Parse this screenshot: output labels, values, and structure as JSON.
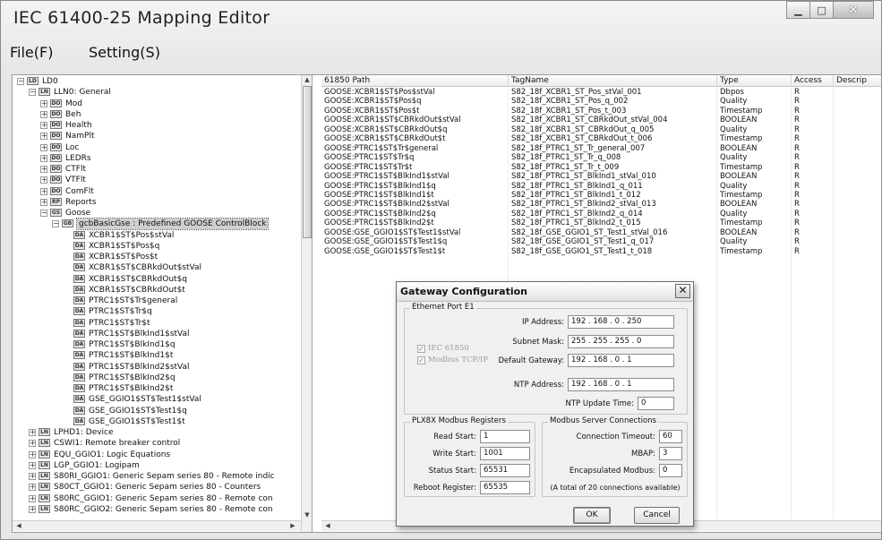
{
  "window": {
    "title": "IEC 61400-25 Mapping Editor",
    "minimize": "▁",
    "maximize": "□",
    "close": "✕"
  },
  "menu": {
    "file": "File(F)",
    "setting": "Setting(S)"
  },
  "tree": {
    "nodes": [
      {
        "label": "LD0",
        "icon": "LD",
        "exp": "−",
        "indent": 0
      },
      {
        "label": "LLN0: General",
        "icon": "LN",
        "exp": "−",
        "indent": 1
      },
      {
        "label": "Mod",
        "icon": "DO",
        "exp": "+",
        "indent": 2
      },
      {
        "label": "Beh",
        "icon": "DO",
        "exp": "+",
        "indent": 2
      },
      {
        "label": "Health",
        "icon": "DO",
        "exp": "+",
        "indent": 2
      },
      {
        "label": "NamPlt",
        "icon": "DO",
        "exp": "+",
        "indent": 2
      },
      {
        "label": "Loc",
        "icon": "DO",
        "exp": "+",
        "indent": 2
      },
      {
        "label": "LEDRs",
        "icon": "DO",
        "exp": "+",
        "indent": 2
      },
      {
        "label": "CTFlt",
        "icon": "DO",
        "exp": "+",
        "indent": 2
      },
      {
        "label": "VTFlt",
        "icon": "DO",
        "exp": "+",
        "indent": 2
      },
      {
        "label": "ComFlt",
        "icon": "DO",
        "exp": "+",
        "indent": 2
      },
      {
        "label": "Reports",
        "icon": "RP",
        "exp": "+",
        "indent": 2
      },
      {
        "label": "Goose",
        "icon": "GS",
        "exp": "−",
        "indent": 2
      },
      {
        "label": "gcbBasicGse : Predefined GOOSE ControlBlock",
        "icon": "GB",
        "exp": "−",
        "indent": 3,
        "selected": true
      },
      {
        "label": "XCBR1$ST$Pos$stVal",
        "icon": "DA",
        "indent": 4
      },
      {
        "label": "XCBR1$ST$Pos$q",
        "icon": "DA",
        "indent": 4
      },
      {
        "label": "XCBR1$ST$Pos$t",
        "icon": "DA",
        "indent": 4
      },
      {
        "label": "XCBR1$ST$CBRkdOut$stVal",
        "icon": "DA",
        "indent": 4
      },
      {
        "label": "XCBR1$ST$CBRkdOut$q",
        "icon": "DA",
        "indent": 4
      },
      {
        "label": "XCBR1$ST$CBRkdOut$t",
        "icon": "DA",
        "indent": 4
      },
      {
        "label": "PTRC1$ST$Tr$general",
        "icon": "DA",
        "indent": 4
      },
      {
        "label": "PTRC1$ST$Tr$q",
        "icon": "DA",
        "indent": 4
      },
      {
        "label": "PTRC1$ST$Tr$t",
        "icon": "DA",
        "indent": 4
      },
      {
        "label": "PTRC1$ST$BlkInd1$stVal",
        "icon": "DA",
        "indent": 4
      },
      {
        "label": "PTRC1$ST$BlkInd1$q",
        "icon": "DA",
        "indent": 4
      },
      {
        "label": "PTRC1$ST$BlkInd1$t",
        "icon": "DA",
        "indent": 4
      },
      {
        "label": "PTRC1$ST$BlkInd2$stVal",
        "icon": "DA",
        "indent": 4
      },
      {
        "label": "PTRC1$ST$BlkInd2$q",
        "icon": "DA",
        "indent": 4
      },
      {
        "label": "PTRC1$ST$BlkInd2$t",
        "icon": "DA",
        "indent": 4
      },
      {
        "label": "GSE_GGIO1$ST$Test1$stVal",
        "icon": "DA",
        "indent": 4
      },
      {
        "label": "GSE_GGIO1$ST$Test1$q",
        "icon": "DA",
        "indent": 4
      },
      {
        "label": "GSE_GGIO1$ST$Test1$t",
        "icon": "DA",
        "indent": 4
      },
      {
        "label": "LPHD1: Device",
        "icon": "LN",
        "exp": "+",
        "indent": 1
      },
      {
        "label": "CSWI1: Remote breaker control",
        "icon": "LN",
        "exp": "+",
        "indent": 1
      },
      {
        "label": "EQU_GGIO1: Logic Equations",
        "icon": "LN",
        "exp": "+",
        "indent": 1
      },
      {
        "label": "LGP_GGIO1: Logipam",
        "icon": "LN",
        "exp": "+",
        "indent": 1
      },
      {
        "label": "S80RI_GGIO1: Generic Sepam series 80 - Remote indic",
        "icon": "LN",
        "exp": "+",
        "indent": 1
      },
      {
        "label": "S80CT_GGIO1: Generic Sepam series 80 - Counters",
        "icon": "LN",
        "exp": "+",
        "indent": 1
      },
      {
        "label": "S80RC_GGIO1: Generic Sepam series 80 - Remote con",
        "icon": "LN",
        "exp": "+",
        "indent": 1
      },
      {
        "label": "S80RC_GGIO2: Generic Sepam series 80 - Remote con",
        "icon": "LN",
        "exp": "+",
        "indent": 1
      }
    ]
  },
  "grid": {
    "headers": [
      "61850 Path",
      "TagName",
      "Type",
      "Access",
      "Descrip"
    ],
    "rows": [
      [
        "GOOSE:XCBR1$ST$Pos$stVal",
        "S82_18f_XCBR1_ST_Pos_stVal_001",
        "Dbpos",
        "R"
      ],
      [
        "GOOSE:XCBR1$ST$Pos$q",
        "S82_18f_XCBR1_ST_Pos_q_002",
        "Quality",
        "R"
      ],
      [
        "GOOSE:XCBR1$ST$Pos$t",
        "S82_18f_XCBR1_ST_Pos_t_003",
        "Timestamp",
        "R"
      ],
      [
        "GOOSE:XCBR1$ST$CBRkdOut$stVal",
        "S82_18f_XCBR1_ST_CBRkdOut_stVal_004",
        "BOOLEAN",
        "R"
      ],
      [
        "GOOSE:XCBR1$ST$CBRkdOut$q",
        "S82_18f_XCBR1_ST_CBRkdOut_q_005",
        "Quality",
        "R"
      ],
      [
        "GOOSE:XCBR1$ST$CBRkdOut$t",
        "S82_18f_XCBR1_ST_CBRkdOut_t_006",
        "Timestamp",
        "R"
      ],
      [
        "GOOSE:PTRC1$ST$Tr$general",
        "S82_18f_PTRC1_ST_Tr_general_007",
        "BOOLEAN",
        "R"
      ],
      [
        "GOOSE:PTRC1$ST$Tr$q",
        "S82_18f_PTRC1_ST_Tr_q_008",
        "Quality",
        "R"
      ],
      [
        "GOOSE:PTRC1$ST$Tr$t",
        "S82_18f_PTRC1_ST_Tr_t_009",
        "Timestamp",
        "R"
      ],
      [
        "GOOSE:PTRC1$ST$BlkInd1$stVal",
        "S82_18f_PTRC1_ST_BlkInd1_stVal_010",
        "BOOLEAN",
        "R"
      ],
      [
        "GOOSE:PTRC1$ST$BlkInd1$q",
        "S82_18f_PTRC1_ST_BlkInd1_q_011",
        "Quality",
        "R"
      ],
      [
        "GOOSE:PTRC1$ST$BlkInd1$t",
        "S82_18f_PTRC1_ST_BlkInd1_t_012",
        "Timestamp",
        "R"
      ],
      [
        "GOOSE:PTRC1$ST$BlkInd2$stVal",
        "S82_18f_PTRC1_ST_BlkInd2_stVal_013",
        "BOOLEAN",
        "R"
      ],
      [
        "GOOSE:PTRC1$ST$BlkInd2$q",
        "S82_18f_PTRC1_ST_BlkInd2_q_014",
        "Quality",
        "R"
      ],
      [
        "GOOSE:PTRC1$ST$BlkInd2$t",
        "S82_18f_PTRC1_ST_BlkInd2_t_015",
        "Timestamp",
        "R"
      ],
      [
        "GOOSE:GSE_GGIO1$ST$Test1$stVal",
        "S82_18f_GSE_GGIO1_ST_Test1_stVal_016",
        "BOOLEAN",
        "R"
      ],
      [
        "GOOSE:GSE_GGIO1$ST$Test1$q",
        "S82_18f_GSE_GGIO1_ST_Test1_q_017",
        "Quality",
        "R"
      ],
      [
        "GOOSE:GSE_GGIO1$ST$Test1$t",
        "S82_18f_GSE_GGIO1_ST_Test1_t_018",
        "Timestamp",
        "R"
      ]
    ]
  },
  "dialog": {
    "title": "Gateway Configuration",
    "close": "✕",
    "ethernet": {
      "legend": "Ethernet Port E1",
      "ip_label": "IP Address:",
      "ip_value": "192 . 168 . 0 . 250",
      "mask_label": "Subnet Mask:",
      "mask_value": "255 . 255 . 255 . 0",
      "gateway_label": "Default Gateway:",
      "gateway_value": "192 . 168 . 0 . 1",
      "ntp_label": "NTP Address:",
      "ntp_value": "192 . 168 . 0 . 1",
      "ntp_time_label": "NTP Update Time:",
      "ntp_time_value": "0",
      "chk_iec": "IEC 61850",
      "chk_modbus": "Modbus TCP/IP",
      "chk_mark": "✓"
    },
    "modbus": {
      "legend": "PLX8X Modbus Registers",
      "read_label": "Read Start:",
      "read_value": "1",
      "write_label": "Write Start:",
      "write_value": "1001",
      "status_label": "Status Start:",
      "status_value": "65531",
      "reboot_label": "Reboot Register:",
      "reboot_value": "65535"
    },
    "server": {
      "legend": "Modbus Server Connections",
      "timeout_label": "Connection Timeout:",
      "timeout_value": "60",
      "mbap_label": "MBAP:",
      "mbap_value": "3",
      "encap_label": "Encapsulated Modbus:",
      "encap_value": "0",
      "note": "(A total of 20 connections available)"
    },
    "ok": "OK",
    "cancel": "Cancel"
  }
}
